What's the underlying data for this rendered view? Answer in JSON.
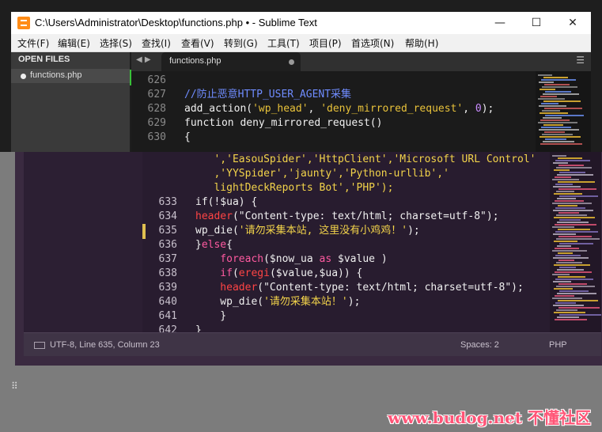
{
  "window_back": {
    "title": "C:\\Users\\Administrator\\Desktop\\functions.php • - Sublime Text",
    "controls": {
      "minimize": "—",
      "maximize": "☐",
      "close": "✕"
    },
    "menu": [
      "文件(F)",
      "编辑(E)",
      "选择(S)",
      "查找(I)",
      "查看(V)",
      "转到(G)",
      "工具(T)",
      "项目(P)",
      "首选项(N)",
      "帮助(H)"
    ],
    "sidebar": {
      "header": "OPEN FILES",
      "file": "functions.php"
    },
    "tab": {
      "label": "functions.php",
      "arrows": "◀  ▶",
      "menu_icon": "☰"
    },
    "code": [
      {
        "n": "626",
        "parts": []
      },
      {
        "n": "627",
        "parts": [
          {
            "t": "//防止恶意HTTP_USER_AGENT采集",
            "c": "c-comment"
          }
        ]
      },
      {
        "n": "628",
        "parts": [
          {
            "t": "add_action(",
            "c": "c-white"
          },
          {
            "t": "'wp_head'",
            "c": "c-str"
          },
          {
            "t": ", ",
            "c": "c-white"
          },
          {
            "t": "'deny_mirrored_request'",
            "c": "c-str"
          },
          {
            "t": ", ",
            "c": "c-white"
          },
          {
            "t": "0",
            "c": "c-num"
          },
          {
            "t": ");",
            "c": "c-white"
          }
        ]
      },
      {
        "n": "629",
        "parts": [
          {
            "t": "function deny_mirrored_request()",
            "c": "c-white"
          }
        ]
      },
      {
        "n": "630",
        "parts": [
          {
            "t": "{",
            "c": "c-white"
          }
        ]
      }
    ]
  },
  "window_front": {
    "code": [
      {
        "n": "",
        "parts": [
          {
            "t": "   ','EasouSpider','HttpClient','Microsoft URL Control'",
            "c": "c-str2"
          }
        ]
      },
      {
        "n": "",
        "parts": [
          {
            "t": "   ,'YYSpider','jaunty','Python-urllib','",
            "c": "c-str2"
          }
        ]
      },
      {
        "n": "",
        "parts": [
          {
            "t": "   lightDeckReports Bot','PHP');",
            "c": "c-str2"
          }
        ]
      },
      {
        "n": "633",
        "parts": [
          {
            "t": "if(!$ua) {",
            "c": "c-white"
          }
        ]
      },
      {
        "n": "634",
        "parts": [
          {
            "t": "header",
            "c": "c-key"
          },
          {
            "t": "(\"Content-type: text/html; charset=utf-8\");",
            "c": "c-white"
          }
        ]
      },
      {
        "n": "635",
        "parts": [
          {
            "t": "wp_die(",
            "c": "c-white"
          },
          {
            "t": "'请勿采集本站, 这里没有小鸡鸡！'",
            "c": "c-str2"
          },
          {
            "t": ");",
            "c": "c-white"
          }
        ]
      },
      {
        "n": "636",
        "parts": [
          {
            "t": "}",
            "c": "c-white"
          },
          {
            "t": "else",
            "c": "c-kw"
          },
          {
            "t": "{",
            "c": "c-white"
          }
        ]
      },
      {
        "n": "637",
        "parts": [
          {
            "t": "    foreach",
            "c": "c-kw"
          },
          {
            "t": "($now_ua ",
            "c": "c-white"
          },
          {
            "t": "as",
            "c": "c-kw"
          },
          {
            "t": " $value )",
            "c": "c-white"
          }
        ]
      },
      {
        "n": "638",
        "parts": [
          {
            "t": "    if",
            "c": "c-kw"
          },
          {
            "t": "(",
            "c": "c-white"
          },
          {
            "t": "eregi",
            "c": "c-key"
          },
          {
            "t": "($value,$ua)) {",
            "c": "c-white"
          }
        ]
      },
      {
        "n": "639",
        "parts": [
          {
            "t": "    header",
            "c": "c-key"
          },
          {
            "t": "(\"Content-type: text/html; charset=utf-8\");",
            "c": "c-white"
          }
        ]
      },
      {
        "n": "640",
        "parts": [
          {
            "t": "    wp_die(",
            "c": "c-white"
          },
          {
            "t": "'请勿采集本站！'",
            "c": "c-str2"
          },
          {
            "t": ");",
            "c": "c-white"
          }
        ]
      },
      {
        "n": "641",
        "parts": [
          {
            "t": "    }",
            "c": "c-white"
          }
        ]
      },
      {
        "n": "642",
        "parts": [
          {
            "t": "}",
            "c": "c-white"
          }
        ]
      }
    ],
    "status": {
      "position": "UTF-8, Line 635, Column 23",
      "spaces": "Spaces: 2",
      "syntax": "PHP"
    }
  },
  "watermark": "www.budog.net 不懂社区"
}
